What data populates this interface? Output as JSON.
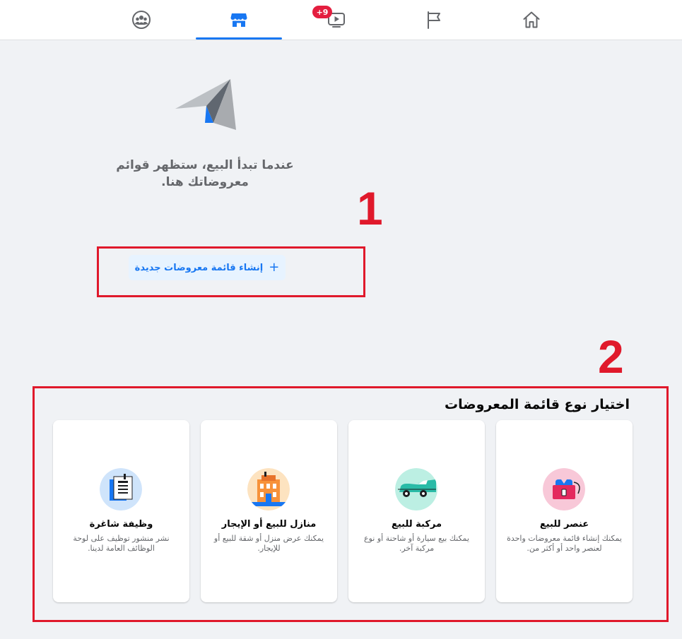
{
  "nav": {
    "tabs": [
      {
        "name": "groups",
        "icon": "groups-icon"
      },
      {
        "name": "marketplace",
        "icon": "marketplace-icon",
        "active": true
      },
      {
        "name": "watch",
        "icon": "watch-icon",
        "badge": "+9"
      },
      {
        "name": "pages",
        "icon": "flag-icon"
      },
      {
        "name": "home",
        "icon": "home-icon"
      }
    ],
    "accent_color": "#1877f2",
    "badge_color": "#e41e3f"
  },
  "empty_state": {
    "icon": "paper-plane-icon",
    "message": "عندما تبدأ البيع، ستظهر قوائم معروضاتك هنا."
  },
  "create_listing": {
    "plus": "+",
    "label": "إنشاء قائمة معروضات جديدة"
  },
  "annotations": {
    "step1": "1",
    "step2": "2",
    "color": "#e0192b"
  },
  "listing_types": {
    "title": "اختيار نوع قائمة المعروضات",
    "cards": [
      {
        "title": "عنصر للبيع",
        "description": "يمكنك إنشاء قائمة معروضات واحدة لعنصر واحد أو أكثر من.",
        "icon": "item-icon"
      },
      {
        "title": "مركبة للبيع",
        "description": "يمكنك بيع سيارة أو شاحنة أو نوع مركبة آخر.",
        "icon": "vehicle-icon"
      },
      {
        "title": "منازل للبيع أو الإيجار",
        "description": "يمكنك عرض منزل أو شقة للبيع أو للإيجار.",
        "icon": "house-icon"
      },
      {
        "title": "وظيفة شاغرة",
        "description": "نشر منشور توظيف على لوحة الوظائف العامة لدينا.",
        "icon": "job-icon"
      }
    ]
  }
}
